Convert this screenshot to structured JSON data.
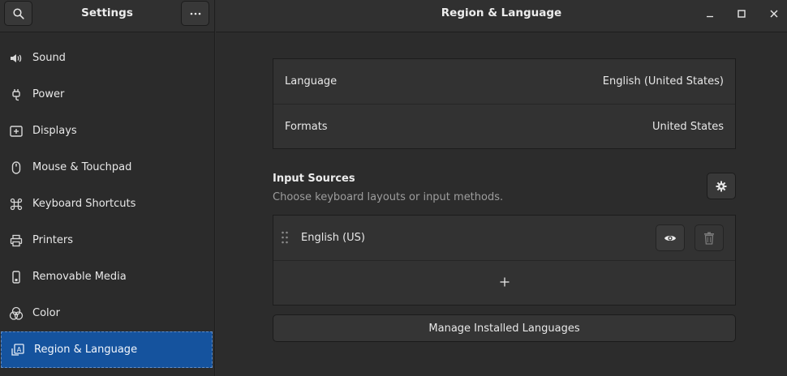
{
  "sidebar": {
    "title": "Settings",
    "search_icon": "search-icon",
    "menu_icon": "more-horizontal-icon",
    "items": [
      {
        "label": "Sound",
        "icon": "speaker-icon"
      },
      {
        "label": "Power",
        "icon": "power-plug-icon"
      },
      {
        "label": "Displays",
        "icon": "display-icon"
      },
      {
        "label": "Mouse & Touchpad",
        "icon": "mouse-icon"
      },
      {
        "label": "Keyboard Shortcuts",
        "icon": "command-key-icon"
      },
      {
        "label": "Printers",
        "icon": "printer-icon"
      },
      {
        "label": "Removable Media",
        "icon": "usb-drive-icon"
      },
      {
        "label": "Color",
        "icon": "color-circles-icon"
      },
      {
        "label": "Region & Language",
        "icon": "language-icon",
        "active": true
      }
    ]
  },
  "main": {
    "title": "Region & Language",
    "language": {
      "label": "Language",
      "value": "English (United States)"
    },
    "formats": {
      "label": "Formats",
      "value": "United States"
    },
    "input_sources": {
      "title": "Input Sources",
      "subtitle": "Choose keyboard layouts or input methods.",
      "items": [
        {
          "name": "English (US)"
        }
      ]
    },
    "manage_label": "Manage Installed Languages"
  },
  "colors": {
    "accent": "#15539e",
    "background": "#2c2c2c",
    "card": "#323232"
  }
}
